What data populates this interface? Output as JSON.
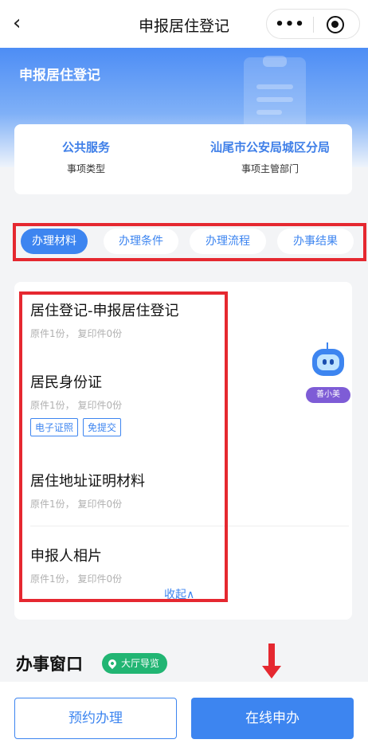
{
  "nav": {
    "back_icon": "‹",
    "title": "申报居住登记",
    "more_icon": "•••"
  },
  "banner": {
    "title": "申报居住登记",
    "icon": "clipboard-icon"
  },
  "info": {
    "service_type_value": "公共服务",
    "service_type_label": "事项类型",
    "department_value": "汕尾市公安局城区分局",
    "department_label": "事项主管部门"
  },
  "tabs": [
    {
      "label": "办理材料",
      "active": true
    },
    {
      "label": "办理条件",
      "active": false
    },
    {
      "label": "办理流程",
      "active": false
    },
    {
      "label": "办事结果",
      "active": false
    }
  ],
  "materials": [
    {
      "name": "居住登记-申报居住登记",
      "copies": "原件1份， 复印件0份",
      "tags": []
    },
    {
      "name": "居民身份证",
      "copies": "原件1份， 复印件0份",
      "tags": [
        "电子证照",
        "免提交"
      ]
    },
    {
      "name": "居住地址证明材料",
      "copies": "原件1份， 复印件0份",
      "tags": []
    },
    {
      "name": "申报人相片",
      "copies": "原件1份， 复印件0份",
      "tags": []
    }
  ],
  "collapse_label": "收起",
  "collapse_icon": "∧",
  "assistant": {
    "label": "善小美",
    "icon": "robot-icon"
  },
  "window_section": {
    "title": "办事窗口",
    "guide_label": "大厅导览",
    "guide_icon": "location-pin-icon"
  },
  "actions": {
    "appointment": "预约办理",
    "online": "在线申办"
  },
  "colors": {
    "primary": "#3d85f0",
    "highlight": "#e52830",
    "guide": "#21b573",
    "assistant_badge": "#7e5cd6"
  }
}
